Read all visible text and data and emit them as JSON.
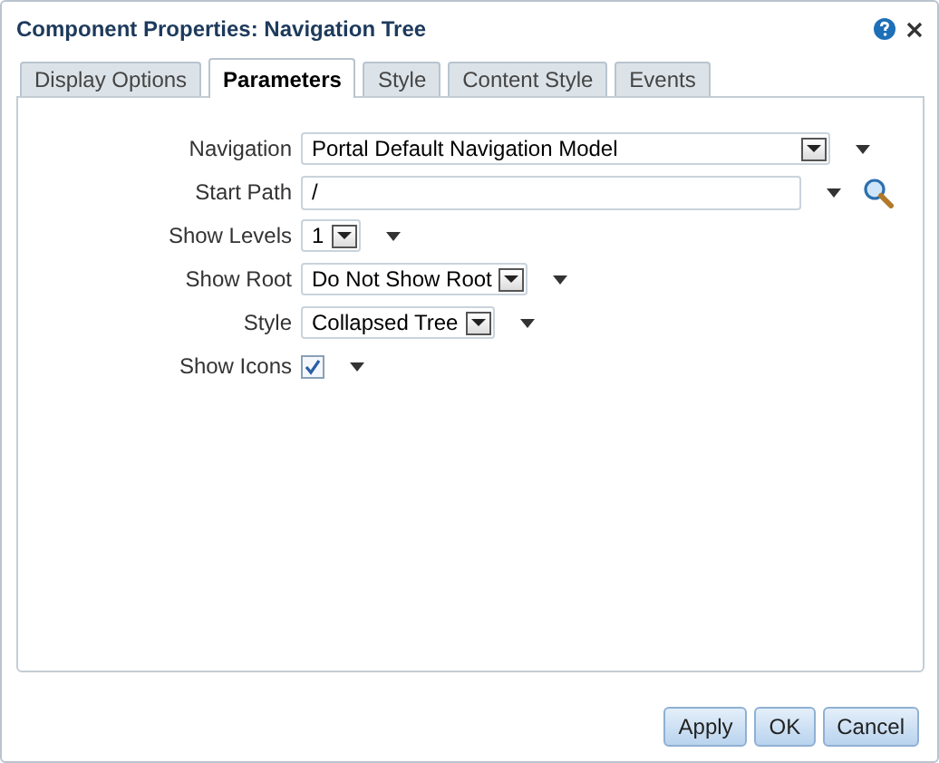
{
  "window": {
    "title": "Component Properties: Navigation Tree"
  },
  "tabs": [
    {
      "label": "Display Options",
      "selected": false
    },
    {
      "label": "Parameters",
      "selected": true
    },
    {
      "label": "Style",
      "selected": false
    },
    {
      "label": "Content Style",
      "selected": false
    },
    {
      "label": "Events",
      "selected": false
    }
  ],
  "fields": [
    {
      "label": "Navigation",
      "kind": "wide-select",
      "value": "Portal Default Navigation Model"
    },
    {
      "label": "Start Path",
      "kind": "path",
      "value": "/"
    },
    {
      "label": "Show Levels",
      "kind": "select",
      "value": "1"
    },
    {
      "label": "Show Root",
      "kind": "select",
      "value": "Do Not Show Root"
    },
    {
      "label": "Style",
      "kind": "select",
      "value": "Collapsed Tree"
    },
    {
      "label": "Show Icons",
      "kind": "checkbox",
      "checked": true
    }
  ],
  "buttons": [
    "Apply",
    "OK",
    "Cancel"
  ]
}
